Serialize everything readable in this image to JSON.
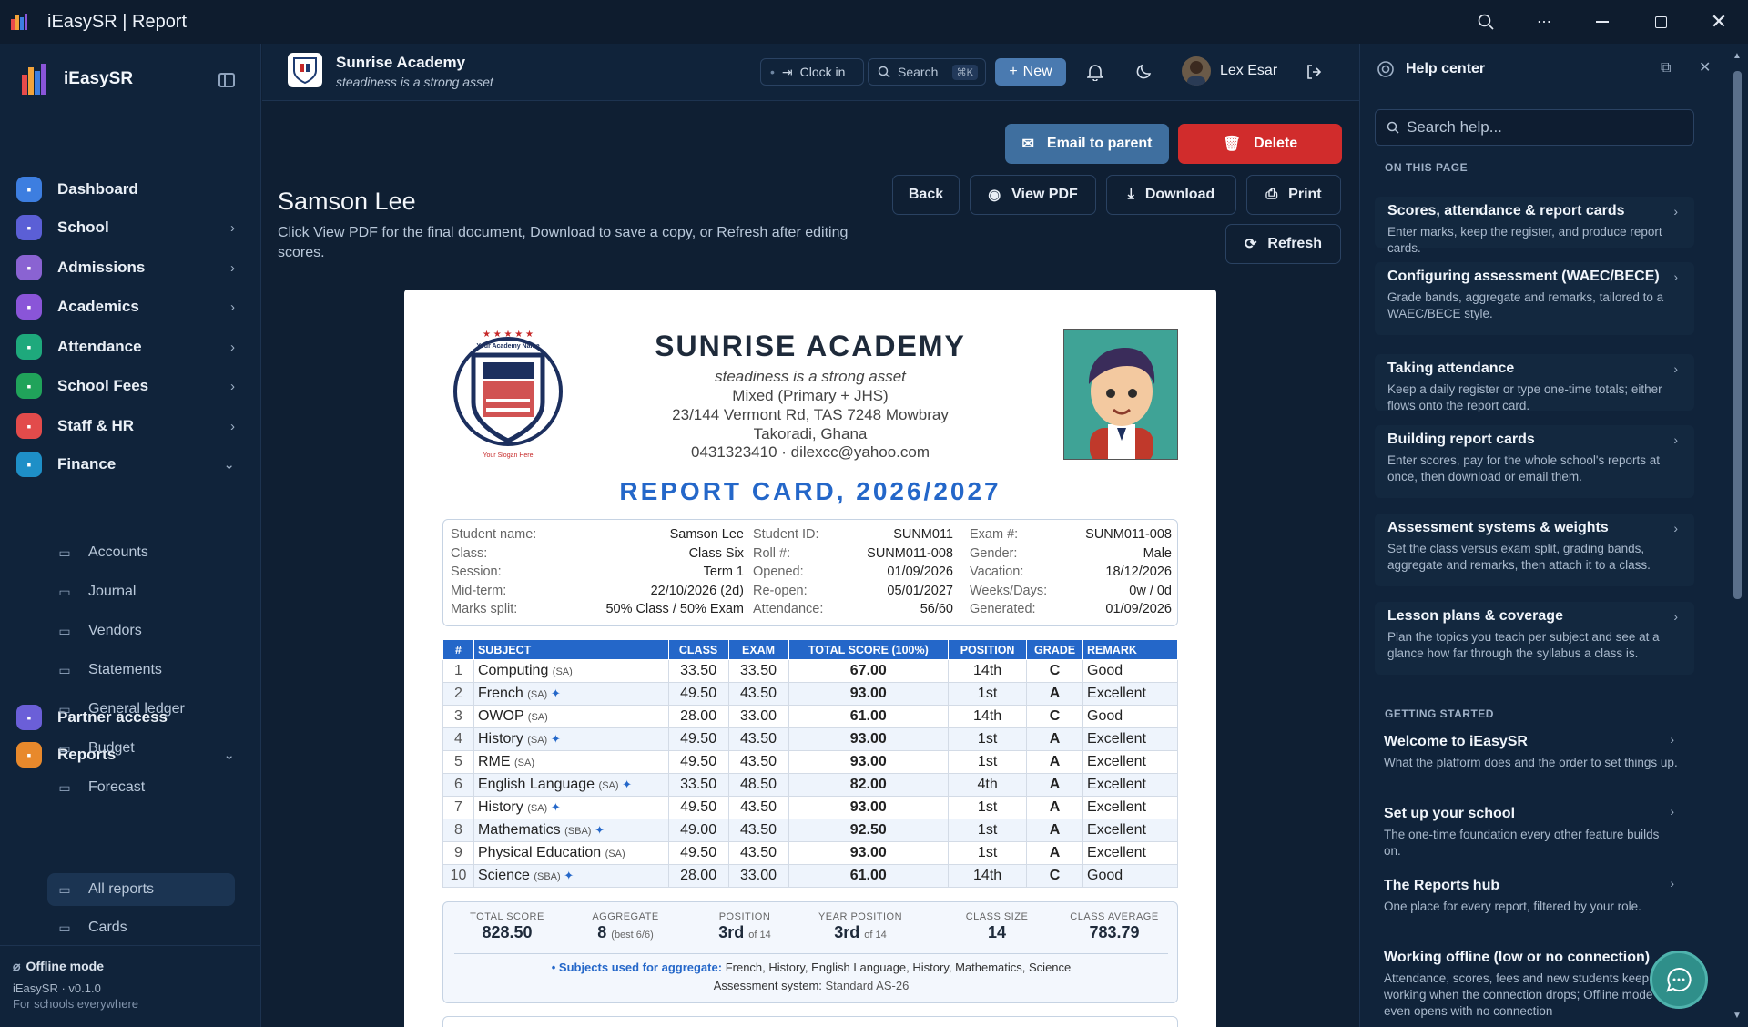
{
  "window": {
    "title": "iEasySR | Report"
  },
  "sidebar": {
    "brand": "iEasySR",
    "items": [
      {
        "label": "Dashboard",
        "icon": "home-icon",
        "color": "#3d7ee0"
      },
      {
        "label": "School",
        "icon": "building-icon",
        "color": "#5b5fd6"
      },
      {
        "label": "Admissions",
        "icon": "user-plus-icon",
        "color": "#8a63d2"
      },
      {
        "label": "Academics",
        "icon": "graduation-cap-icon",
        "color": "#8a55d8"
      },
      {
        "label": "Attendance",
        "icon": "calendar-check-icon",
        "color": "#1ea97c"
      },
      {
        "label": "School Fees",
        "icon": "receipt-icon",
        "color": "#20a35a"
      },
      {
        "label": "Staff & HR",
        "icon": "id-card-icon",
        "color": "#e24b4b"
      },
      {
        "label": "Finance",
        "icon": "bank-icon",
        "color": "#1e8fc7"
      },
      {
        "label": "Partner access",
        "icon": "shield-icon",
        "color": "#6b5fd8"
      },
      {
        "label": "Reports",
        "icon": "bar-chart-icon",
        "color": "#e8892c"
      }
    ],
    "finance_sub": [
      "Accounts",
      "Journal",
      "Vendors",
      "Statements",
      "General ledger",
      "Budget",
      "Forecast"
    ],
    "reports_sub": [
      "All reports",
      "Cards"
    ],
    "footer": {
      "offline": "Offline mode",
      "version": "iEasySR · v0.1.0",
      "tagline": "For schools everywhere"
    }
  },
  "topbar": {
    "school_name": "Sunrise Academy",
    "school_tagline": "steadiness is a strong asset",
    "clock_in": "Clock in",
    "search": "Search",
    "search_kbd": "⌘K",
    "new": "New",
    "user": "Lex Esar"
  },
  "page": {
    "email": "Email to parent",
    "delete": "Delete",
    "back": "Back",
    "view_pdf": "View PDF",
    "download": "Download",
    "print": "Print",
    "refresh": "Refresh",
    "title": "Samson Lee",
    "description": "Click View PDF for the final document, Download to save a copy, or Refresh after editing scores."
  },
  "report": {
    "crest_top": "Your Academy Name",
    "crest_bottom": "Your Slogan Here",
    "school": "SUNRISE ACADEMY",
    "motto": "steadiness is a strong asset",
    "type": "Mixed (Primary + JHS)",
    "address1": "23/144 Vermont Rd, TAS 7248 Mowbray",
    "address2": "Takoradi, Ghana",
    "contact": "0431323410 · dilexcc@yahoo.com",
    "title": "REPORT CARD, 2026/2027",
    "info": [
      [
        [
          "Student name:",
          "Samson Lee"
        ],
        [
          "Student ID:",
          "SUNM011"
        ],
        [
          "Exam #:",
          "SUNM011-008"
        ]
      ],
      [
        [
          "Class:",
          "Class Six"
        ],
        [
          "Roll #:",
          "SUNM011-008"
        ],
        [
          "Gender:",
          "Male"
        ]
      ],
      [
        [
          "Session:",
          "Term 1"
        ],
        [
          "Opened:",
          "01/09/2026"
        ],
        [
          "Vacation:",
          "18/12/2026"
        ]
      ],
      [
        [
          "Mid-term:",
          "22/10/2026 (2d)"
        ],
        [
          "Re-open:",
          "05/01/2027"
        ],
        [
          "Weeks/Days:",
          "0w / 0d"
        ]
      ],
      [
        [
          "Marks split:",
          "50% Class / 50% Exam"
        ],
        [
          "Attendance:",
          "56/60"
        ],
        [
          "Generated:",
          "01/09/2026"
        ]
      ]
    ],
    "columns": [
      "#",
      "SUBJECT",
      "CLASS",
      "EXAM",
      "TOTAL SCORE (100%)",
      "POSITION",
      "GRADE",
      "REMARK"
    ],
    "rows": [
      {
        "n": "1",
        "s": "Computing",
        "t": "(SA)",
        "star": false,
        "c": "33.50",
        "e": "33.50",
        "tot": "67.00",
        "p": "14th",
        "g": "C",
        "r": "Good"
      },
      {
        "n": "2",
        "s": "French",
        "t": "(SA)",
        "star": true,
        "c": "49.50",
        "e": "43.50",
        "tot": "93.00",
        "p": "1st",
        "g": "A",
        "r": "Excellent"
      },
      {
        "n": "3",
        "s": "OWOP",
        "t": "(SA)",
        "star": false,
        "c": "28.00",
        "e": "33.00",
        "tot": "61.00",
        "p": "14th",
        "g": "C",
        "r": "Good"
      },
      {
        "n": "4",
        "s": "History",
        "t": "(SA)",
        "star": true,
        "c": "49.50",
        "e": "43.50",
        "tot": "93.00",
        "p": "1st",
        "g": "A",
        "r": "Excellent"
      },
      {
        "n": "5",
        "s": "RME",
        "t": "(SA)",
        "star": false,
        "c": "49.50",
        "e": "43.50",
        "tot": "93.00",
        "p": "1st",
        "g": "A",
        "r": "Excellent"
      },
      {
        "n": "6",
        "s": "English Language",
        "t": "(SA)",
        "star": true,
        "c": "33.50",
        "e": "48.50",
        "tot": "82.00",
        "p": "4th",
        "g": "A",
        "r": "Excellent"
      },
      {
        "n": "7",
        "s": "History",
        "t": "(SA)",
        "star": true,
        "c": "49.50",
        "e": "43.50",
        "tot": "93.00",
        "p": "1st",
        "g": "A",
        "r": "Excellent"
      },
      {
        "n": "8",
        "s": "Mathematics",
        "t": "(SBA)",
        "star": true,
        "c": "49.00",
        "e": "43.50",
        "tot": "92.50",
        "p": "1st",
        "g": "A",
        "r": "Excellent"
      },
      {
        "n": "9",
        "s": "Physical Education",
        "t": "(SA)",
        "star": false,
        "c": "49.50",
        "e": "43.50",
        "tot": "93.00",
        "p": "1st",
        "g": "A",
        "r": "Excellent"
      },
      {
        "n": "10",
        "s": "Science",
        "t": "(SBA)",
        "star": true,
        "c": "28.00",
        "e": "33.00",
        "tot": "61.00",
        "p": "14th",
        "g": "C",
        "r": "Good"
      }
    ],
    "summary": {
      "total_label": "TOTAL SCORE",
      "total": "828.50",
      "agg_label": "AGGREGATE",
      "agg": "8",
      "agg_note": "(best 6/6)",
      "pos_label": "POSITION",
      "pos": "3rd",
      "pos_note": "of 14",
      "ypos_label": "YEAR POSITION",
      "ypos": "3rd",
      "ypos_note": "of 14",
      "size_label": "CLASS SIZE",
      "size": "14",
      "avg_label": "CLASS AVERAGE",
      "avg": "783.79",
      "agg_subjects_label": "• Subjects used for aggregate:",
      "agg_subjects": "French, History, English Language, History, Mathematics, Science",
      "system_label": "Assessment system:",
      "system": "Standard AS-26"
    }
  },
  "help": {
    "title": "Help center",
    "search_placeholder": "Search help...",
    "on_this_page": "ON THIS PAGE",
    "page_items": [
      {
        "t": "Scores, attendance & report cards",
        "d": "Enter marks, keep the register, and produce report cards."
      },
      {
        "t": "Configuring assessment (WAEC/BECE)",
        "d": "Grade bands, aggregate and remarks, tailored to a WAEC/BECE style."
      },
      {
        "t": "Taking attendance",
        "d": "Keep a daily register or type one-time totals; either flows onto the report card."
      },
      {
        "t": "Building report cards",
        "d": "Enter scores, pay for the whole school's reports at once, then download or email them."
      },
      {
        "t": "Assessment systems & weights",
        "d": "Set the class versus exam split, grading bands, aggregate and remarks, then attach it to a class."
      },
      {
        "t": "Lesson plans & coverage",
        "d": "Plan the topics you teach per subject and see at a glance how far through the syllabus a class is."
      }
    ],
    "getting_started": "GETTING STARTED",
    "start_items": [
      {
        "t": "Welcome to iEasySR",
        "d": "What the platform does and the order to set things up."
      },
      {
        "t": "Set up your school",
        "d": "The one-time foundation every other feature builds on."
      },
      {
        "t": "The Reports hub",
        "d": "One place for every report, filtered by your role."
      },
      {
        "t": "Working offline (low or no connection)",
        "d": "Attendance, scores, fees and new students keep working when the connection drops; Offline mode even opens with no connection"
      }
    ]
  }
}
